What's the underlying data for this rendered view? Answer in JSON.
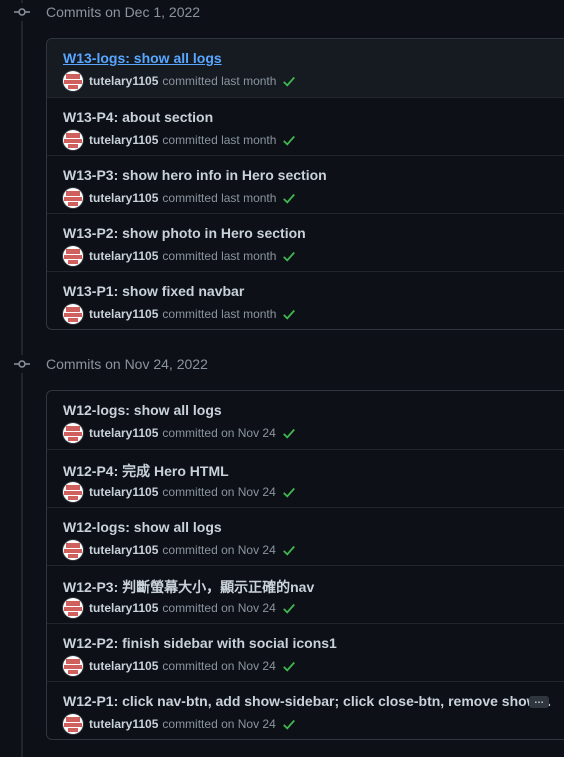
{
  "groups": [
    {
      "title": "Commits on Dec 1, 2022",
      "commits": [
        {
          "message": "W13-logs: show all logs",
          "author": "tutelary1105",
          "when": "committed last month",
          "link": true
        },
        {
          "message": "W13-P4: about section",
          "author": "tutelary1105",
          "when": "committed last month"
        },
        {
          "message": "W13-P3: show hero info in Hero section",
          "author": "tutelary1105",
          "when": "committed last month"
        },
        {
          "message": "W13-P2: show photo in Hero section",
          "author": "tutelary1105",
          "when": "committed last month"
        },
        {
          "message": "W13-P1: show fixed navbar",
          "author": "tutelary1105",
          "when": "committed last month"
        }
      ]
    },
    {
      "title": "Commits on Nov 24, 2022",
      "commits": [
        {
          "message": "W12-logs: show all logs",
          "author": "tutelary1105",
          "when": "committed on Nov 24"
        },
        {
          "message": "W12-P4: 完成 Hero HTML",
          "author": "tutelary1105",
          "when": "committed on Nov 24"
        },
        {
          "message": "W12-logs: show all logs",
          "author": "tutelary1105",
          "when": "committed on Nov 24"
        },
        {
          "message": "W12-P3: 判斷螢幕大小，顯示正確的nav",
          "author": "tutelary1105",
          "when": "committed on Nov 24"
        },
        {
          "message": "W12-P2: finish sidebar with social icons1",
          "author": "tutelary1105",
          "when": "committed on Nov 24"
        },
        {
          "message": "W12-P1: click nav-btn, add show-sidebar; click close-btn, remove show…",
          "author": "tutelary1105",
          "when": "committed on Nov 24",
          "ellipsis": "…"
        }
      ]
    }
  ],
  "icons": {
    "group": "git-commit-icon",
    "status": "check-icon"
  },
  "colors": {
    "link": "#58a6ff",
    "check": "#3fb950",
    "avatar": "#d0605e"
  }
}
